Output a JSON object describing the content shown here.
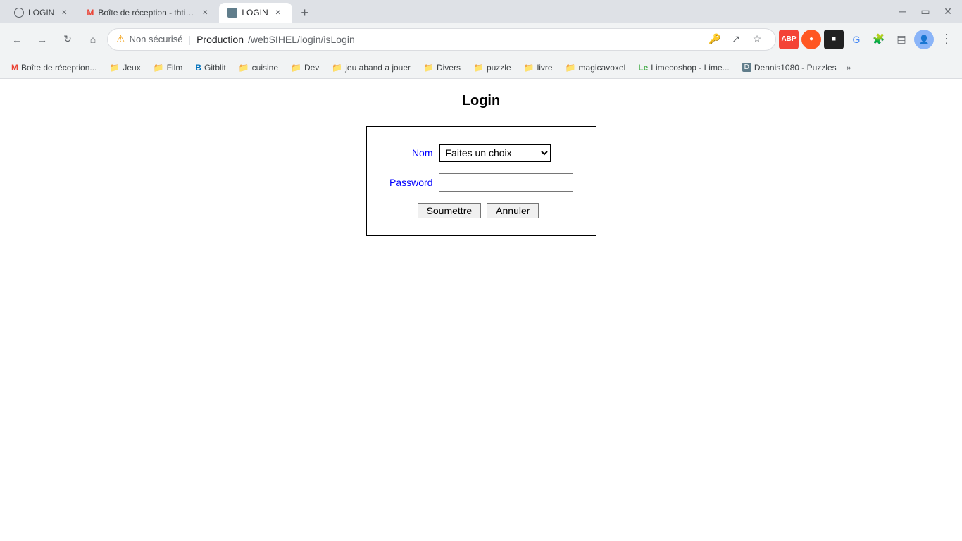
{
  "tabs": [
    {
      "id": "tab1",
      "title": "LOGIN",
      "icon": "globe",
      "active": false,
      "closeable": true
    },
    {
      "id": "tab2",
      "title": "Boîte de réception - thtioxine@g",
      "icon": "gmail",
      "active": false,
      "closeable": true
    },
    {
      "id": "tab3",
      "title": "LOGIN",
      "icon": "image",
      "active": true,
      "closeable": true
    }
  ],
  "addressBar": {
    "warning": "⚠",
    "insecure_label": "Non sécurisé",
    "site": "Production",
    "path": "/webSIHEL/login/isLogin"
  },
  "bookmarks": [
    {
      "label": "Boîte de réception...",
      "icon": "M"
    },
    {
      "label": "Jeux",
      "icon": "📁"
    },
    {
      "label": "Film",
      "icon": "📁"
    },
    {
      "label": "Gitblit",
      "icon": "B"
    },
    {
      "label": "cuisine",
      "icon": "📁"
    },
    {
      "label": "Dev",
      "icon": "📁"
    },
    {
      "label": "jeu aband a jouer",
      "icon": "📁"
    },
    {
      "label": "Divers",
      "icon": "📁"
    },
    {
      "label": "puzzle",
      "icon": "📁"
    },
    {
      "label": "livre",
      "icon": "📁"
    },
    {
      "label": "magicavoxel",
      "icon": "📁"
    },
    {
      "label": "Limecoshop - Lime...",
      "icon": "L"
    },
    {
      "label": "Dennis1080 - Puzzles",
      "icon": "D"
    }
  ],
  "page": {
    "title": "Login",
    "form": {
      "nom_label": "Nom",
      "nom_placeholder": "Faites un choix",
      "password_label": "Password",
      "submit_label": "Soumettre",
      "cancel_label": "Annuler"
    }
  },
  "nav": {
    "back_disabled": false,
    "forward_disabled": false
  }
}
